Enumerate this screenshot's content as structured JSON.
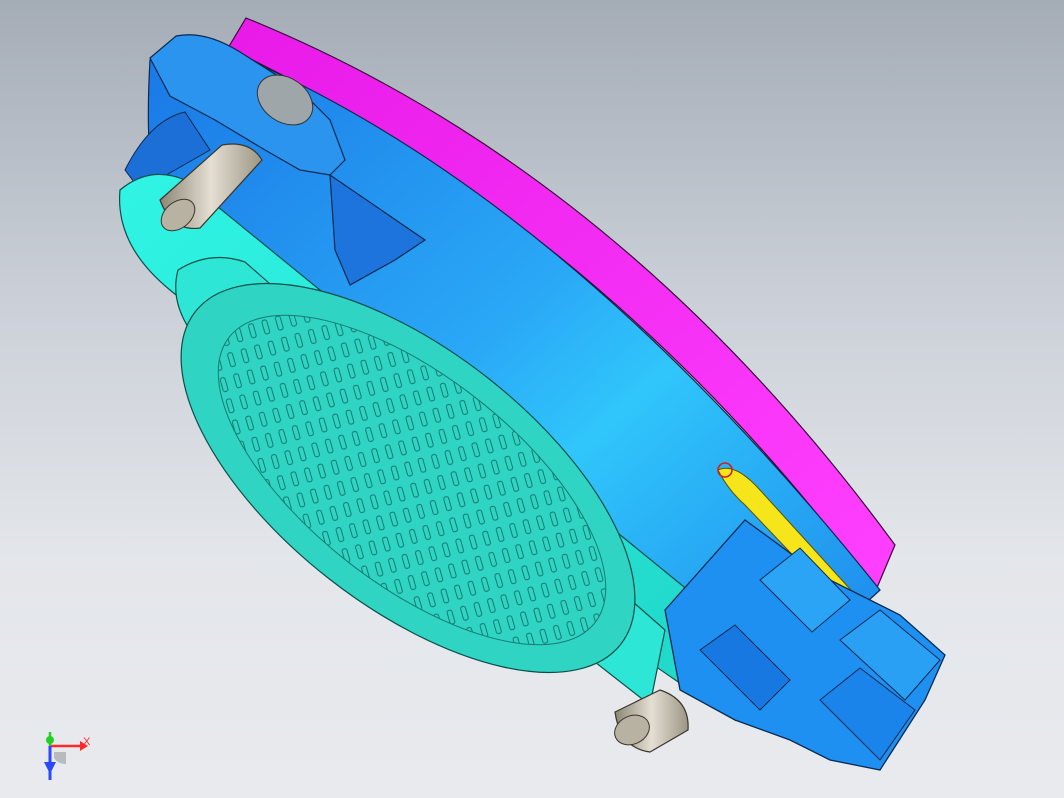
{
  "viewport": {
    "background_top": "#a4acb6",
    "background_bottom": "#e8eaee"
  },
  "model": {
    "colors": {
      "rim": "#ff22ff",
      "body": "#2a98f0",
      "base_plate": "#28f0e0",
      "grille": "#2fd8c4",
      "pin": "#c8c2b4",
      "connector": "#1e90f2",
      "wire": "#f5e51a"
    },
    "icons": [
      "pin-icon",
      "connector-icon",
      "grille-icon"
    ]
  },
  "triad": {
    "x_label": "X",
    "colors": {
      "x": "#ff2a2a",
      "y": "#22d022",
      "z": "#2a48ff"
    }
  }
}
